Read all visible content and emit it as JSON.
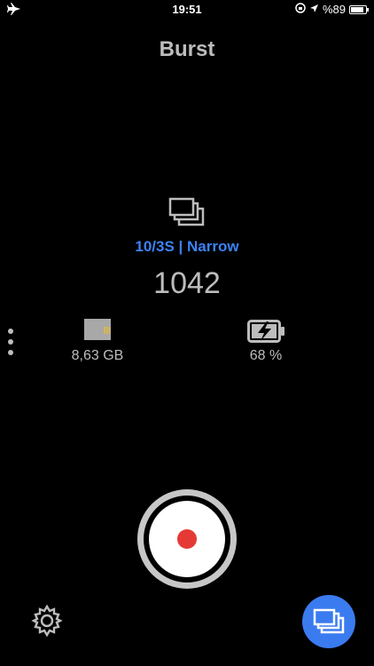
{
  "status_bar": {
    "time": "19:51",
    "battery_percent": "%89",
    "icons": [
      "airplane-icon",
      "orientation-lock-icon",
      "location-arrow-icon",
      "battery-icon"
    ]
  },
  "header": {
    "title": "Burst"
  },
  "mode": {
    "icon": "burst-icon",
    "label": "10/3S | Narrow",
    "accent_color": "#3b82f6"
  },
  "shots": {
    "count": "1042"
  },
  "storage": {
    "icon": "sd-card-icon",
    "value": "8,63 GB"
  },
  "battery": {
    "icon": "battery-charging-icon",
    "value": "68 %"
  },
  "controls": {
    "more_icon": "more-vertical-icon",
    "record_icon": "record-icon",
    "settings_icon": "gear-icon",
    "mode_button_icon": "burst-icon",
    "record_color": "#e53935",
    "fab_color": "#3a7bf0"
  }
}
